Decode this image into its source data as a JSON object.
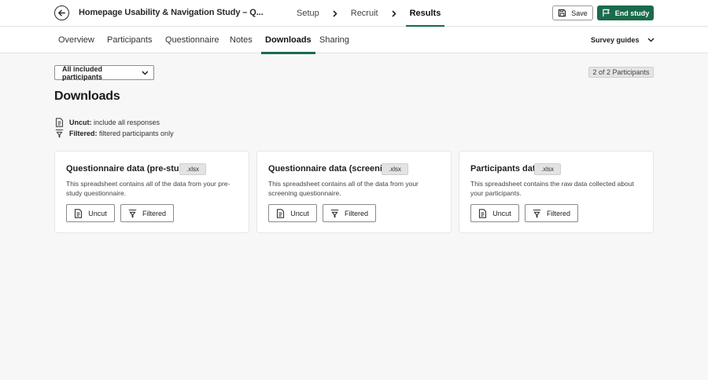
{
  "header": {
    "back_icon": "arrow-left-icon",
    "study_title": "Homepage Usability & Navigation Study – Q...",
    "steps": [
      {
        "label": "Setup"
      },
      {
        "label": "Recruit"
      },
      {
        "label": "Results",
        "active": true
      }
    ],
    "save_label": "Save",
    "end_study_label": "End study",
    "accent_color": "#1a6b4c"
  },
  "tabs": {
    "items": [
      {
        "label": "Overview"
      },
      {
        "label": "Participants"
      },
      {
        "label": "Questionnaire"
      },
      {
        "label": "Notes"
      },
      {
        "label": "Downloads",
        "active": true
      },
      {
        "label": "Sharing"
      }
    ],
    "survey_guides_label": "Survey guides"
  },
  "toolbar": {
    "participant_filter": "All included participants",
    "participant_count": "2 of 2 Participants"
  },
  "page": {
    "title": "Downloads",
    "legend": {
      "uncut_key": "Uncut:",
      "uncut_text": " include all responses",
      "filtered_key": "Filtered:",
      "filtered_text": " filtered participants only"
    }
  },
  "cards": [
    {
      "title": "Questionnaire data (pre-study)",
      "extension": ".xlsx",
      "description": "This spreadsheet contains all of the data from your pre-study questionnaire.",
      "uncut_label": "Uncut",
      "filtered_label": "Filtered"
    },
    {
      "title": "Questionnaire data (screening)",
      "extension": ".xlsx",
      "description": "This spreadsheet contains all of the data from your screening questionnaire.",
      "uncut_label": "Uncut",
      "filtered_label": "Filtered"
    },
    {
      "title": "Participants data",
      "extension": ".xlsx",
      "description": "This spreadsheet contains the raw data collected about your participants.",
      "uncut_label": "Uncut",
      "filtered_label": "Filtered"
    }
  ]
}
